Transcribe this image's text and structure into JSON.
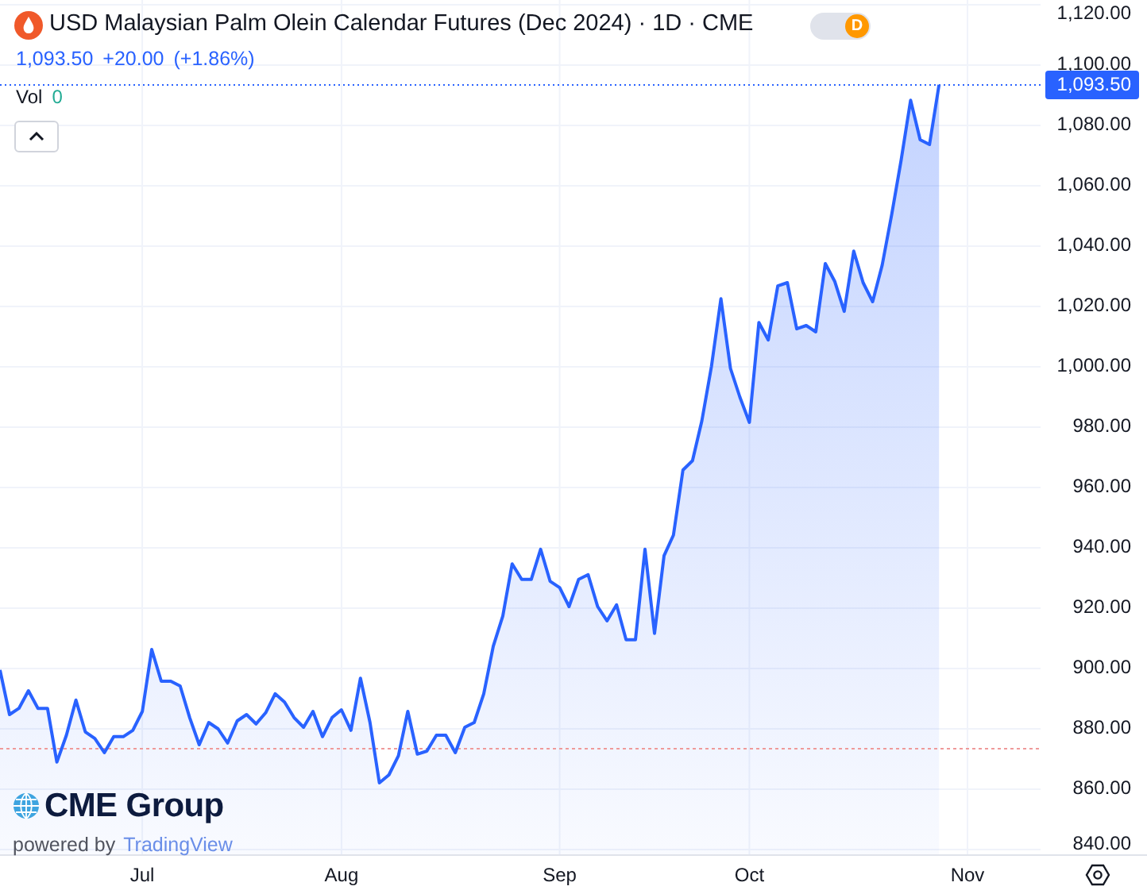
{
  "header": {
    "title": "USD Malaysian Palm Olein Calendar Futures (Dec 2024) · 1D · CME",
    "badge": "D",
    "quote": {
      "price": "1,093.50",
      "change": "+20.00",
      "change_pct": "(+1.86%)"
    },
    "volume": {
      "label": "Vol",
      "value": "0"
    }
  },
  "chart": {
    "last_price_label": "1,093.50",
    "chart_data": {
      "type": "area",
      "grid": true,
      "categories": [
        null,
        null,
        null,
        null,
        null,
        null,
        null,
        null,
        null,
        null,
        null,
        null,
        null,
        null,
        null,
        "Jul",
        null,
        null,
        null,
        null,
        null,
        null,
        null,
        null,
        null,
        null,
        null,
        null,
        null,
        null,
        null,
        null,
        null,
        null,
        null,
        null,
        "Aug",
        null,
        null,
        null,
        null,
        null,
        null,
        null,
        null,
        null,
        null,
        null,
        null,
        null,
        null,
        null,
        null,
        null,
        null,
        null,
        null,
        null,
        null,
        "Sep",
        null,
        null,
        null,
        null,
        null,
        null,
        null,
        null,
        null,
        null,
        null,
        null,
        null,
        null,
        null,
        null,
        null,
        null,
        null,
        "Oct",
        null,
        null,
        null,
        null,
        null,
        null,
        null,
        null,
        null,
        null,
        null,
        null,
        null,
        null,
        null,
        null,
        null,
        null,
        null,
        null,
        null,
        null,
        "Nov",
        null,
        null,
        null,
        null,
        null,
        null,
        null
      ],
      "ref_lines": [
        {
          "axis": "y",
          "value": 873.9,
          "color": "#ef9a9a"
        },
        {
          "axis": "y",
          "value": 1093.5,
          "color": "#2962ff"
        }
      ],
      "ylim": [
        838.4,
        1121.6
      ],
      "yticks": [
        {
          "value": 840,
          "label": "840.00"
        },
        {
          "value": 860,
          "label": "860.00"
        },
        {
          "value": 880,
          "label": "880.00"
        },
        {
          "value": 900,
          "label": "900.00"
        },
        {
          "value": 920,
          "label": "920.00"
        },
        {
          "value": 940,
          "label": "940.00"
        },
        {
          "value": 960,
          "label": "960.00"
        },
        {
          "value": 980,
          "label": "980.00"
        },
        {
          "value": 1000,
          "label": "1,000.00"
        },
        {
          "value": 1020,
          "label": "1,020.00"
        },
        {
          "value": 1040,
          "label": "1,040.00"
        },
        {
          "value": 1060,
          "label": "1,060.00"
        },
        {
          "value": 1080,
          "label": "1,080.00"
        },
        {
          "value": 1100,
          "label": "1,100.00"
        },
        {
          "value": 1120,
          "label": "1,120.00"
        }
      ],
      "series": [
        {
          "color": "#2962ff",
          "values": [
            899.5,
            884.7,
            886.8,
            892.6,
            886.8,
            886.8,
            869,
            877.9,
            889.5,
            879,
            876.8,
            872.1,
            877.4,
            877.4,
            879.5,
            885.8,
            906.3,
            895.8,
            895.8,
            894.2,
            883.7,
            874.7,
            882.1,
            880,
            875.3,
            882.6,
            884.7,
            881.6,
            885.3,
            891.6,
            888.9,
            883.7,
            880.5,
            885.8,
            877.4,
            883.7,
            886.3,
            879.5,
            896.8,
            882.1,
            862.1,
            864.7,
            871.1,
            885.8,
            871.6,
            872.6,
            877.9,
            877.9,
            872.1,
            880.5,
            882.1,
            891.6,
            907.4,
            917.4,
            934.7,
            929.5,
            929.5,
            939.5,
            928.9,
            926.8,
            920.5,
            929.5,
            931.1,
            920.5,
            915.8,
            921.1,
            909.5,
            909.5,
            939.5,
            911.6,
            937.4,
            944.2,
            965.8,
            968.9,
            982.1,
            1000,
            1022.6,
            999.5,
            990,
            981.6,
            1014.7,
            1008.9,
            1026.8,
            1027.9,
            1012.6,
            1013.7,
            1011.6,
            1034.2,
            1028.4,
            1018.4,
            1038.4,
            1027.9,
            1021.6,
            1033.7,
            1050.5,
            1068.4,
            1088.4,
            1075.3,
            1073.7,
            1093.5,
            null,
            null,
            null,
            null,
            null,
            null,
            null,
            null,
            null,
            null
          ]
        }
      ]
    }
  },
  "logo": {
    "brand": "CME Group",
    "powered_by": "powered by",
    "platform": "TradingView"
  }
}
